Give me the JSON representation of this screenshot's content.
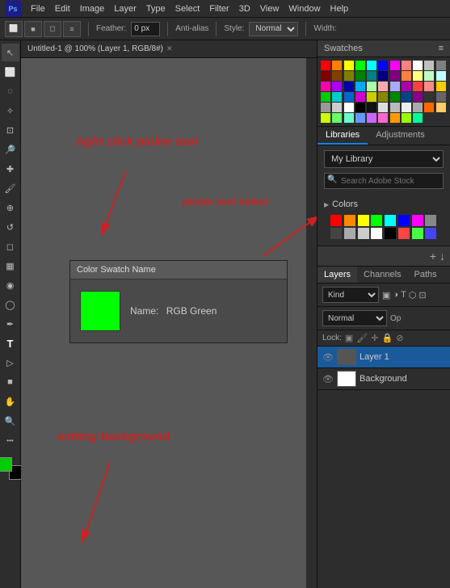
{
  "app": {
    "logo": "Ps",
    "menus": [
      "File",
      "Edit",
      "Image",
      "Layer",
      "Type",
      "Select",
      "Filter",
      "3D",
      "View",
      "Window",
      "Help"
    ]
  },
  "toolbar": {
    "feather_label": "Feather:",
    "feather_value": "0 px",
    "anti_alias_label": "Anti-alias",
    "style_label": "Style:",
    "style_value": "Normal",
    "width_label": "Width:"
  },
  "canvas": {
    "tab_title": "Untitled-1 @ 100% (Layer 1, RGB/8#)",
    "tab_modified": "*"
  },
  "annotations": {
    "right_click": "right click picker tool",
    "picker_select": "picker tool select",
    "setting_bg": "setting background"
  },
  "swatch_dialog": {
    "title": "Color Swatch Name",
    "name_label": "Name:",
    "name_value": "RGB Green"
  },
  "swatches": {
    "header": "Swatches",
    "colors": [
      "#ff0000",
      "#ff8000",
      "#ffff00",
      "#00ff00",
      "#00ffff",
      "#0000ff",
      "#ff00ff",
      "#ff8080",
      "#ffffff",
      "#c0c0c0",
      "#808080",
      "#800000",
      "#804000",
      "#808000",
      "#008000",
      "#008080",
      "#000080",
      "#800080",
      "#ff8040",
      "#ffff80",
      "#c0ffc0",
      "#c0ffff",
      "#ff00aa",
      "#aa00ff",
      "#0000aa",
      "#00aaff",
      "#aaffaa",
      "#ffaaaa",
      "#aaaaff",
      "#aa00aa",
      "#ff4040",
      "#ff8888",
      "#ffcc00",
      "#00cc00",
      "#00cccc",
      "#0066cc",
      "#cc00cc",
      "#cccc00",
      "#888800",
      "#008800",
      "#004488",
      "#880088",
      "#333333",
      "#666666",
      "#999999",
      "#cccccc",
      "#ffffff",
      "#000000",
      "#111111",
      "#dddddd",
      "#bbbbbb",
      "#eeeeee",
      "#aaaaaa",
      "#ff6600",
      "#ffcc66",
      "#ccff00",
      "#66ff66",
      "#66ffcc",
      "#6699ff",
      "#cc66ff",
      "#ff66cc",
      "#ff9900",
      "#99ff00",
      "#00ff99"
    ]
  },
  "libraries": {
    "tabs": [
      "Libraries",
      "Adjustments"
    ],
    "active_tab": "Libraries",
    "my_library": "My Library",
    "search_placeholder": "Search Adobe Stock"
  },
  "colors_section": {
    "label": "Colors",
    "swatches": [
      "#ff0000",
      "#ff8800",
      "#ffff00",
      "#00ff00",
      "#00ffff",
      "#0000ff",
      "#ff00ff",
      "#ffffff",
      "#000000",
      "#888888",
      "#ff4444",
      "#44ff44",
      "#4444ff",
      "#ffff88",
      "#88ffff",
      "#ff88ff",
      "#ff8800",
      "#88ff00"
    ]
  },
  "layers": {
    "toolbar_icons": [
      "+",
      "↓"
    ],
    "tabs": [
      "Layers",
      "Channels",
      "Paths"
    ],
    "active_tab": "Layers",
    "kind_label": "Kind",
    "mode_label": "Normal",
    "opacity_label": "Op",
    "lock_label": "Lock:",
    "items": [
      {
        "name": "Layer 1",
        "visible": true,
        "active": true
      },
      {
        "name": "Background",
        "visible": true,
        "active": false
      }
    ]
  },
  "colors_panel": {
    "swatch_colors": [
      "#ff0000",
      "#ff8800",
      "#ffff00",
      "#00ff00",
      "#00ffff",
      "#0000ff",
      "#ff00ff",
      "#888888",
      "#444444",
      "#aaaaaa",
      "#cccccc",
      "#ffffff",
      "#000000",
      "#ff4444",
      "#44ff44",
      "#4444ff"
    ]
  }
}
